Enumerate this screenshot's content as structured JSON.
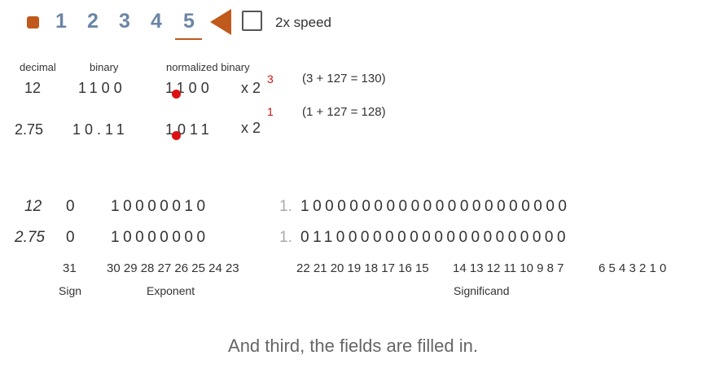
{
  "controls": {
    "steps": [
      "1",
      "2",
      "3",
      "4",
      "5"
    ],
    "active_step": "5",
    "speed_label": "2x speed",
    "speed_checked": false
  },
  "headers": {
    "decimal": "decimal",
    "binary": "binary",
    "normalized": "normalized binary"
  },
  "conversion_rows": [
    {
      "decimal": "12",
      "binary": "1100",
      "normalized": "1100",
      "times": "x 2",
      "exponent": "3",
      "bias": "(3 + 127 = 130)"
    },
    {
      "decimal": "2.75",
      "binary": "10.11",
      "normalized": "1011",
      "times": "x 2",
      "exponent": "1",
      "bias": "(1 + 127 = 128)"
    }
  ],
  "ieee_rows": [
    {
      "label": "12",
      "sign": "0",
      "exponent": "10000010",
      "leading": "1.",
      "significand": "1000000000000000000000"
    },
    {
      "label": "2.75",
      "sign": "0",
      "exponent": "10000000",
      "leading": "1.",
      "significand": "0110000000000000000000"
    }
  ],
  "bit_indices": {
    "sign": "31",
    "exponent": "30 29 28 27 26 25 24 23",
    "significand_a": "22 21 20 19 18 17 16 15",
    "significand_b": "14 13 12 11 10 9 8 7",
    "significand_c": "6 5 4 3 2 1 0"
  },
  "field_labels": {
    "sign": "Sign",
    "exponent": "Exponent",
    "significand": "Significand"
  },
  "caption": "And third, the fields are filled in.",
  "colors": {
    "accent": "#c05a1c",
    "step": "#6b86a6",
    "marker": "#dd1111",
    "exponent": "#cc1111"
  }
}
